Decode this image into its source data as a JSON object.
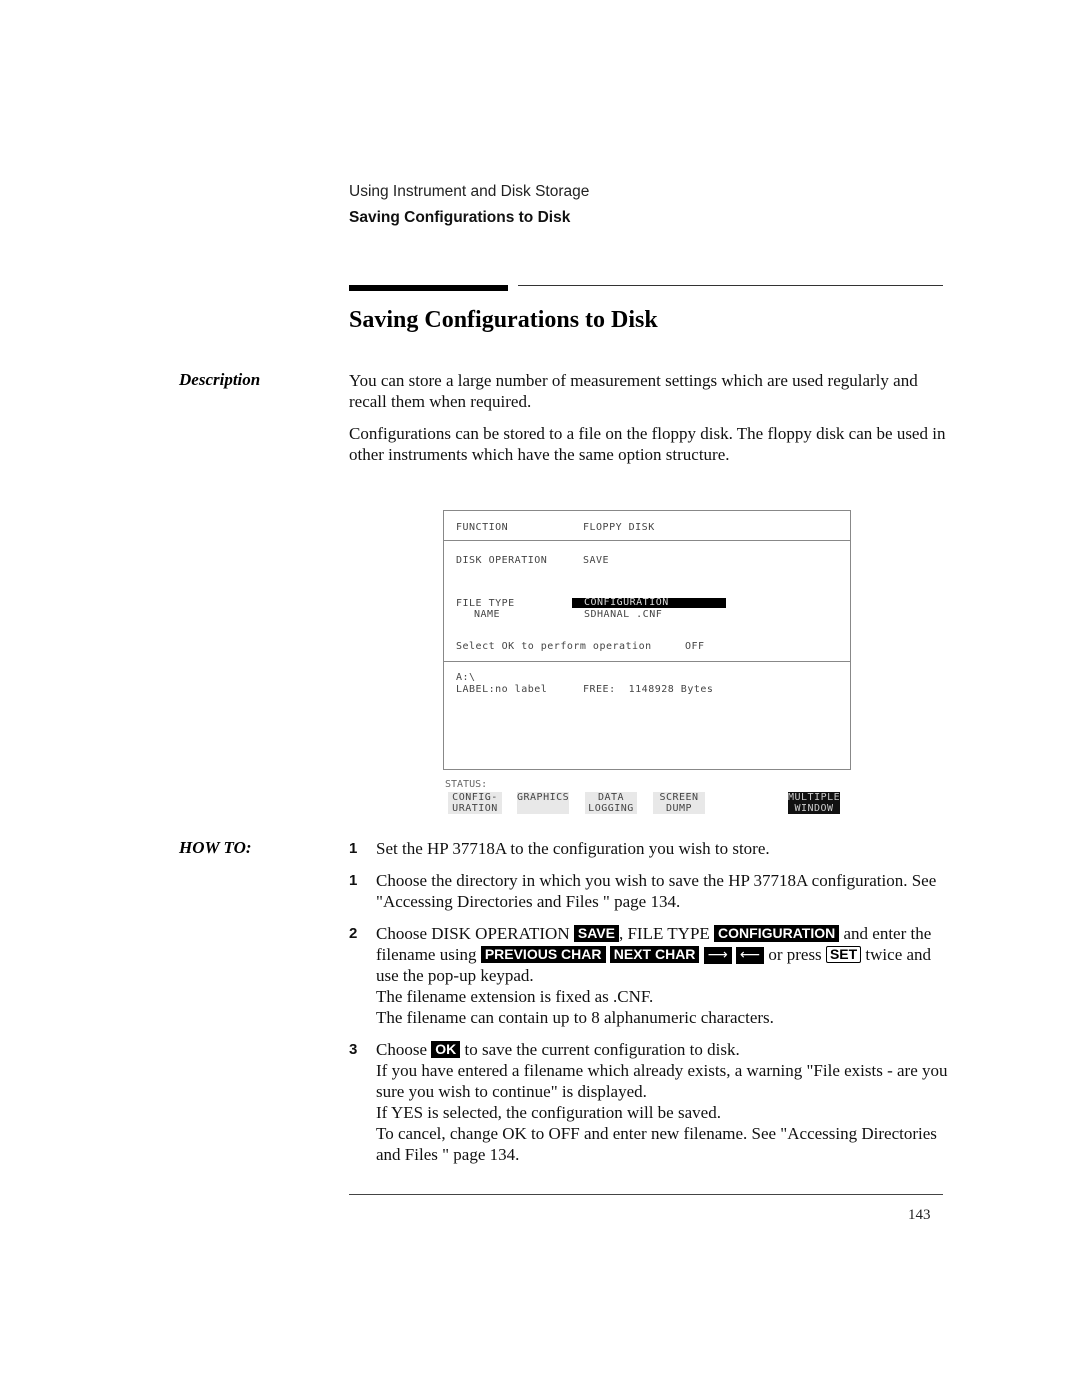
{
  "header": {
    "chapter": "Using Instrument and Disk Storage",
    "section": "Saving Configurations to Disk"
  },
  "title": "Saving Configurations to Disk",
  "description": {
    "label": "Description",
    "paragraphs": [
      "You can store a large number of measurement settings which are used regularly and recall them when required.",
      "Configurations can be stored to a file on the floppy disk. The floppy disk can be used in other instruments which have the same option structure."
    ]
  },
  "instrument_screen": {
    "function_label": "FUNCTION",
    "function_value": "FLOPPY DISK",
    "disk_operation_label": "DISK OPERATION",
    "disk_operation_value": "SAVE",
    "file_type_label": "FILE TYPE",
    "file_type_value": "CONFIGURATION",
    "name_label": "NAME",
    "name_value": "SDHANAL .CNF",
    "select_ok_text": "Select OK to perform operation",
    "select_ok_value": "OFF",
    "drive": "A:\\",
    "label_text": "LABEL:no label",
    "free_text": "FREE:  1148928 Bytes",
    "status_label": "STATUS:",
    "softkeys": [
      {
        "line1": "CONFIG-",
        "line2": "URATION"
      },
      {
        "line1": "GRAPHICS",
        "line2": ""
      },
      {
        "line1": "DATA",
        "line2": "LOGGING"
      },
      {
        "line1": "SCREEN",
        "line2": "DUMP"
      },
      {
        "line1": "MULTIPLE",
        "line2": "WINDOW"
      }
    ]
  },
  "howto": {
    "label": "HOW TO:",
    "steps": [
      {
        "num": "1",
        "text": "Set the HP 37718A to the configuration you wish to store."
      },
      {
        "num": "1",
        "text": "Choose the directory in which you wish to save the HP 37718A configuration. See  \"Accessing Directories and Files \"  page 134."
      },
      {
        "num": "2",
        "p1": "Choose DISK OPERATION ",
        "key_save": "SAVE",
        "p2": ", FILE TYPE ",
        "key_config": "CONFIGURATION",
        "p3": " and enter the filename using ",
        "key_prev": "PREVIOUS CHAR",
        "key_next": "NEXT CHAR",
        "key_right": "⟶",
        "key_left": "⟵",
        "p4": " or press ",
        "key_set": "SET",
        "p5": " twice and use the pop-up  keypad.",
        "line2": "The filename extension is fixed as .CNF.",
        "line3": "The filename can contain up to 8 alphanumeric characters."
      },
      {
        "num": "3",
        "p1": "Choose ",
        "key_ok": "OK",
        "p2": " to save the current configuration to disk.",
        "line2": "If you have entered a filename which already exists, a warning \"File exists - are you sure you wish to continue\" is displayed.",
        "line3": "If YES is selected, the configuration will be saved.",
        "line4": "To cancel, change OK to OFF and enter new filename. See  \"Accessing Directories and Files \"  page 134."
      }
    ]
  },
  "footer": {
    "page_number": "143"
  }
}
